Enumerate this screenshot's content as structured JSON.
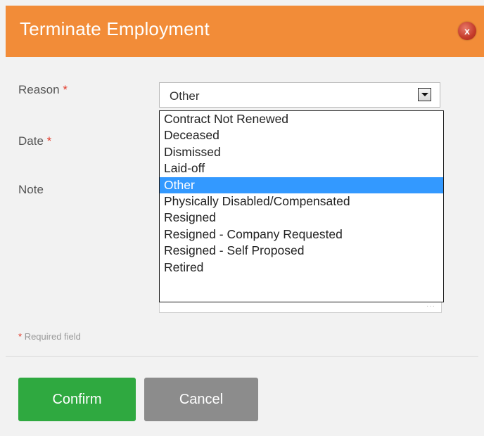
{
  "dialog": {
    "title": "Terminate Employment",
    "close_label": "x"
  },
  "form": {
    "reason_label": "Reason",
    "date_label": "Date",
    "note_label": "Note",
    "required_marker": "*",
    "reason_value": "Other",
    "reason_options": [
      "Contract Not Renewed",
      "Deceased",
      "Dismissed",
      "Laid-off",
      "Other",
      "Physically Disabled/Compensated",
      "Resigned",
      "Resigned - Company Requested",
      "Resigned - Self Proposed",
      "Retired"
    ],
    "required_note": "Required field"
  },
  "buttons": {
    "confirm": "Confirm",
    "cancel": "Cancel"
  },
  "colors": {
    "header": "#f28c38",
    "confirm": "#2fa940",
    "cancel": "#8c8c8c",
    "selected_option": "#3399ff",
    "required": "#e23b2b"
  }
}
